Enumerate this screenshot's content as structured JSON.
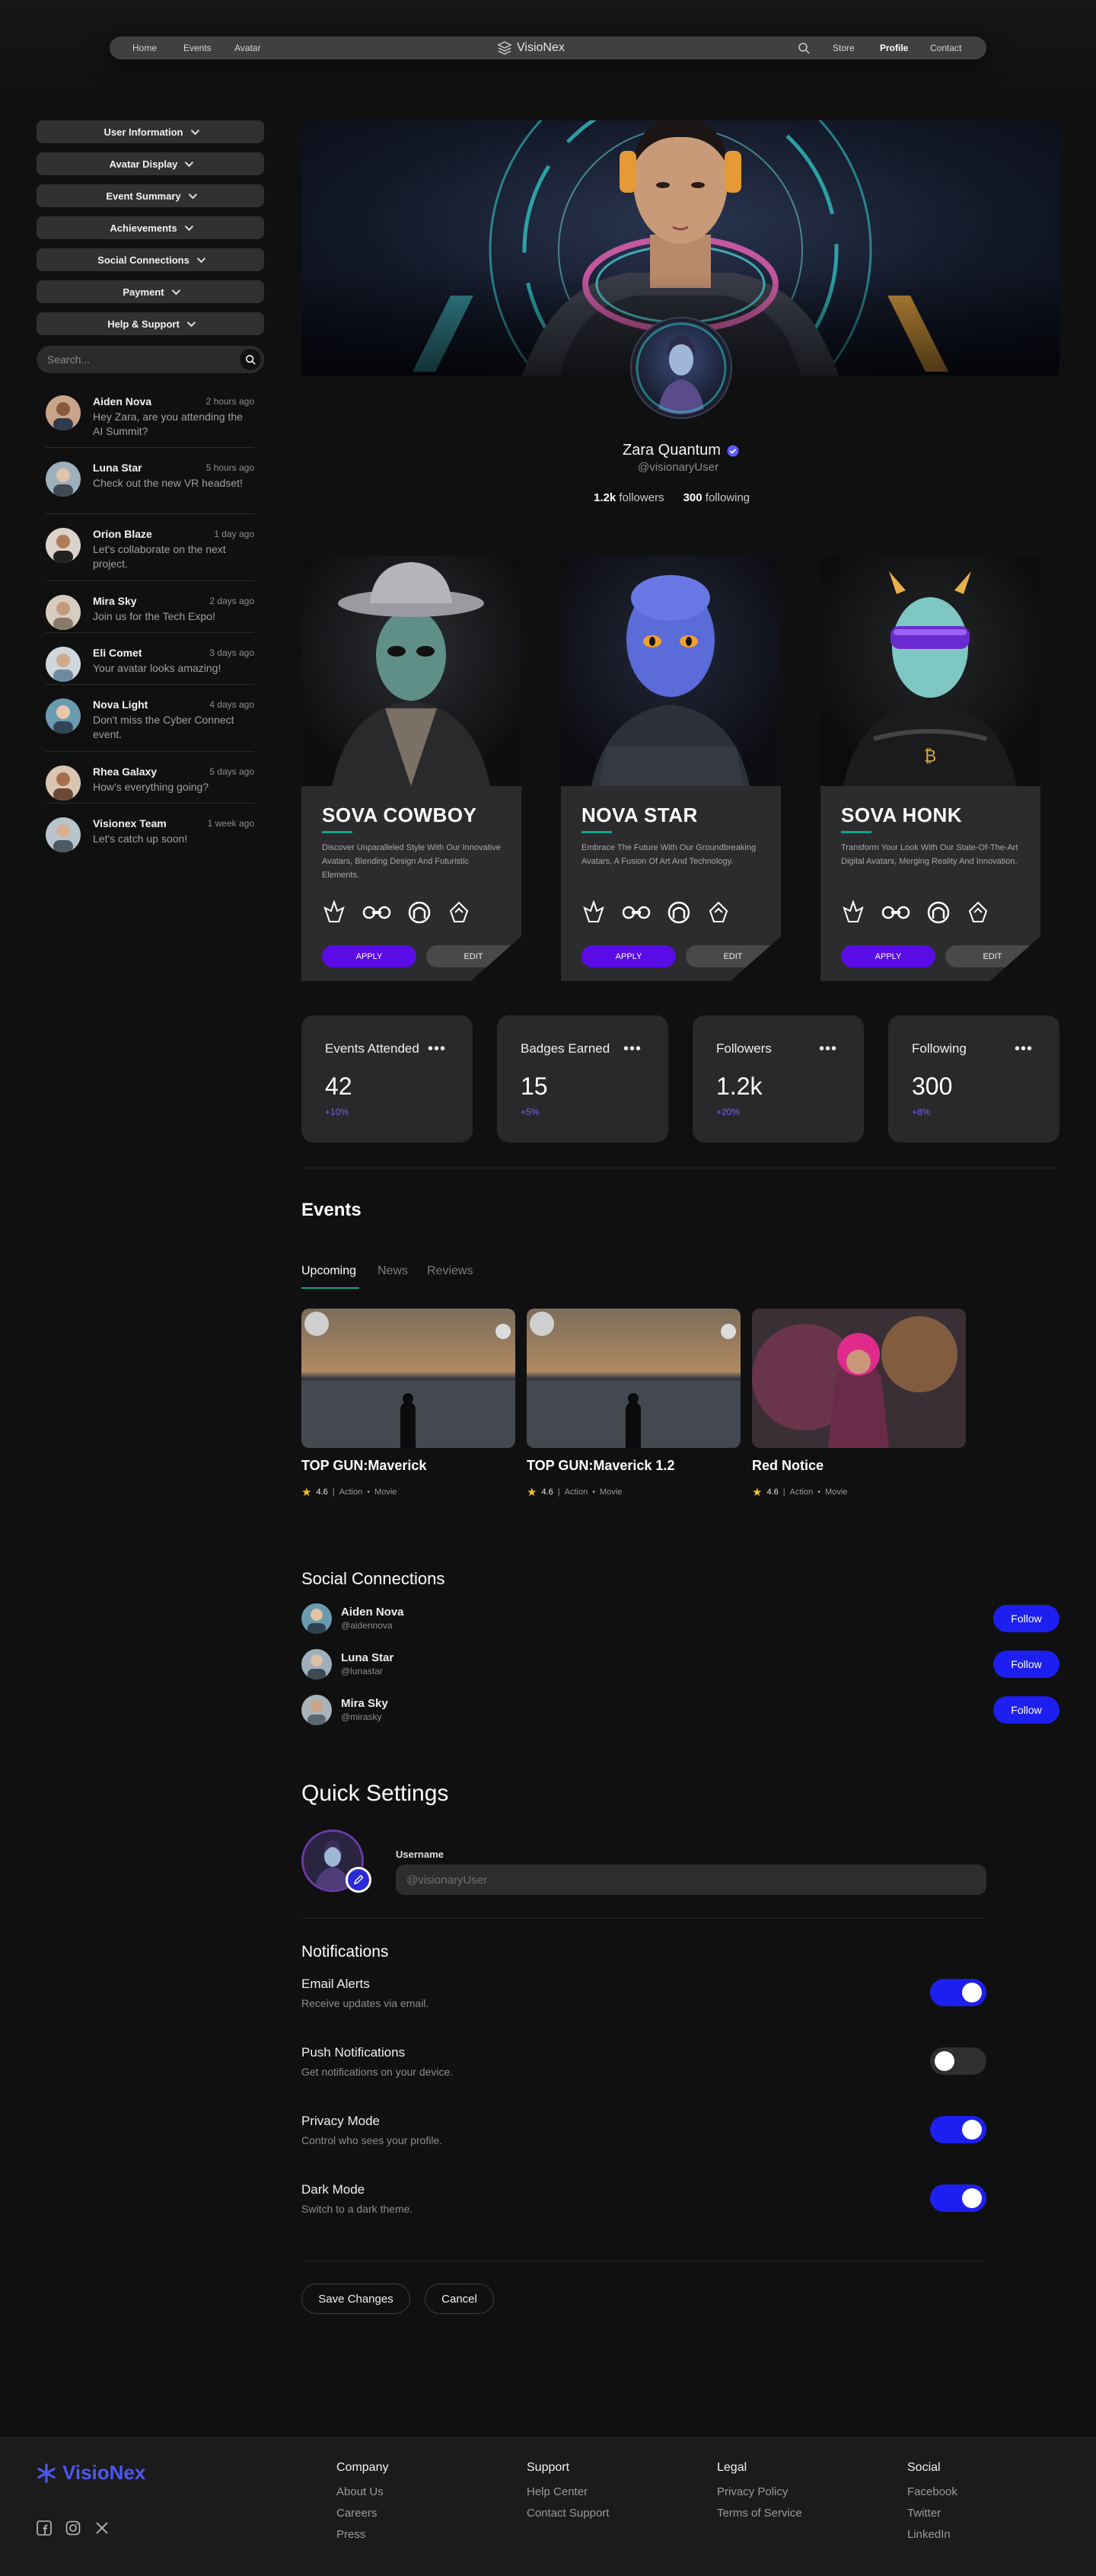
{
  "nav": {
    "links_left": [
      "Home",
      "Events",
      "Avatar"
    ],
    "brand": "VisioNex",
    "links_right": [
      "Store",
      "Profile",
      "Contact"
    ],
    "active": "Profile"
  },
  "sidebar": {
    "menu": [
      "User Information",
      "Avatar Display",
      "Event Summary",
      "Achievements",
      "Social Connections",
      "Payment",
      "Help & Support"
    ],
    "search_placeholder": "Search...",
    "messages": [
      {
        "name": "Aiden Nova",
        "time": "2 hours ago",
        "text": "Hey Zara, are you attending the AI Summit?"
      },
      {
        "name": "Luna Star",
        "time": "5 hours ago",
        "text": "Check out the new VR headset!"
      },
      {
        "name": "Orion Blaze",
        "time": "1 day ago",
        "text": "Let's collaborate on the next project."
      },
      {
        "name": "Mira Sky",
        "time": "2 days ago",
        "text": "Join us for the Tech Expo!"
      },
      {
        "name": "Eli Comet",
        "time": "3 days ago",
        "text": "Your avatar looks amazing!"
      },
      {
        "name": "Nova Light",
        "time": "4 days ago",
        "text": "Don't miss the Cyber Connect event."
      },
      {
        "name": "Rhea Galaxy",
        "time": "5 days ago",
        "text": "How's everything going?"
      },
      {
        "name": "Visionex Team",
        "time": "1 week ago",
        "text": "Let's catch up soon!"
      }
    ]
  },
  "profile": {
    "name": "Zara Quantum",
    "handle": "@visionaryUser",
    "followers_count": "1.2k",
    "followers_label": "followers",
    "following_count": "300",
    "following_label": "following"
  },
  "cards": [
    {
      "title": "SOVA COWBOY",
      "desc": "Discover Unparalleled Style With Our Innovative Avatars, Blending Design And Futuristic Elements.",
      "apply": "APPLY",
      "edit": "EDIT"
    },
    {
      "title": "NOVA STAR",
      "desc": "Embrace The Future With Our Groundbreaking Avatars, A Fusion Of Art And Technology.",
      "apply": "APPLY",
      "edit": "EDIT"
    },
    {
      "title": "SOVA HONK",
      "desc": "Transform Your Look With Our State-Of-The-Art Digital Avatars, Merging Reality And Innovation.",
      "apply": "APPLY",
      "edit": "EDIT"
    }
  ],
  "stats": [
    {
      "label": "Events Attended",
      "value": "42",
      "change": "+10%"
    },
    {
      "label": "Badges Earned",
      "value": "15",
      "change": "+5%"
    },
    {
      "label": "Followers",
      "value": "1.2k",
      "change": "+20%"
    },
    {
      "label": "Following",
      "value": "300",
      "change": "+8%"
    }
  ],
  "events": {
    "heading": "Events",
    "tabs": [
      "Upcoming",
      "News",
      "Reviews"
    ],
    "active_tab": "Upcoming",
    "items": [
      {
        "title": "TOP GUN:Maverick",
        "rating": "4.6",
        "genre": "Action",
        "type": "Movie"
      },
      {
        "title": "TOP GUN:Maverick 1.2",
        "rating": "4.6",
        "genre": "Action",
        "type": "Movie"
      },
      {
        "title": "Red Notice",
        "rating": "4.6",
        "genre": "Action",
        "type": "Movie"
      }
    ]
  },
  "social": {
    "heading": "Social Connections",
    "button": "Follow",
    "items": [
      {
        "name": "Aiden Nova",
        "handle": "@aidennova"
      },
      {
        "name": "Luna Star",
        "handle": "@lunastar"
      },
      {
        "name": "Mira Sky",
        "handle": "@mirasky"
      }
    ]
  },
  "settings": {
    "heading": "Quick Settings",
    "username_label": "Username",
    "username_placeholder": "@visionaryUser",
    "notifications_heading": "Notifications",
    "items": [
      {
        "title": "Email Alerts",
        "desc": "Receive updates via email.",
        "on": true
      },
      {
        "title": "Push Notifications",
        "desc": "Get notifications on your device.",
        "on": false
      },
      {
        "title": "Privacy Mode",
        "desc": "Control who sees your profile.",
        "on": true
      },
      {
        "title": "Dark Mode",
        "desc": "Switch to a dark theme.",
        "on": true
      }
    ],
    "save": "Save Changes",
    "cancel": "Cancel"
  },
  "footer": {
    "brand": "VisioNex",
    "columns": [
      {
        "heading": "Company",
        "links": [
          "About Us",
          "Careers",
          "Press"
        ]
      },
      {
        "heading": "Support",
        "links": [
          "Help Center",
          "Contact Support"
        ]
      },
      {
        "heading": "Legal",
        "links": [
          "Privacy Policy",
          "Terms of Service"
        ]
      },
      {
        "heading": "Social",
        "links": [
          "Facebook",
          "Twitter",
          "LinkedIn"
        ]
      }
    ]
  },
  "colors": {
    "accent_blue": "#1d1ff0",
    "apply_purple": "#5a0ce6",
    "teal": "#13a38d",
    "brand": "#4c57f0",
    "change": "#7a5cf0"
  }
}
